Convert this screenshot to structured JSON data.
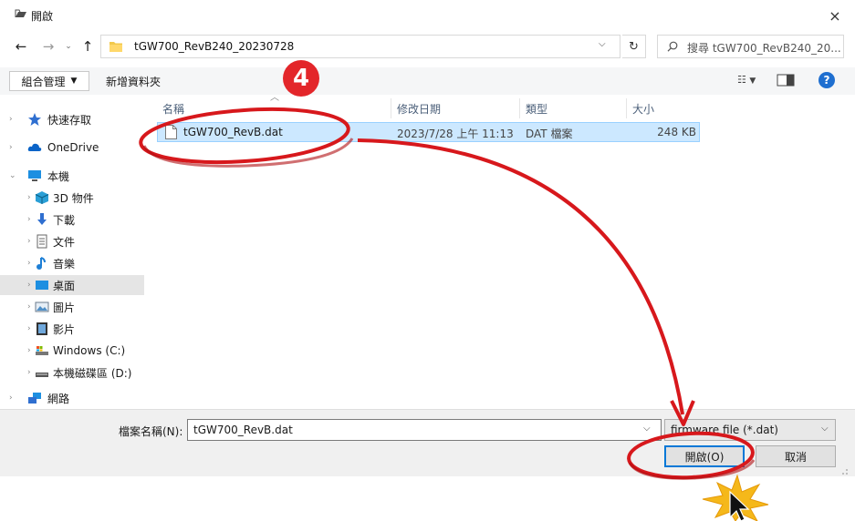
{
  "window": {
    "title": "開啟",
    "title_icon": "open-folder-icon",
    "close_glyph": "×"
  },
  "address_bar": {
    "path": "tGW700_RevB240_20230728",
    "search_placeholder": "搜尋 tGW700_RevB240_20..."
  },
  "toolbar": {
    "organize_label": "組合管理",
    "new_folder_label": "新增資料夾"
  },
  "columns": {
    "name": "名稱",
    "date": "修改日期",
    "type": "類型",
    "size": "大小"
  },
  "files": [
    {
      "name": "tGW700_RevB.dat",
      "date": "2023/7/28 上午 11:13",
      "type": "DAT 檔案",
      "size": "248 KB"
    }
  ],
  "nav": [
    {
      "label": "快速存取",
      "icon": "star-icon"
    },
    {
      "label": "OneDrive",
      "icon": "cloud-icon"
    },
    {
      "label": "本機",
      "icon": "computer-icon"
    },
    {
      "label": "3D 物件",
      "icon": "cube-icon"
    },
    {
      "label": "下載",
      "icon": "download-icon"
    },
    {
      "label": "文件",
      "icon": "document-icon"
    },
    {
      "label": "音樂",
      "icon": "music-icon"
    },
    {
      "label": "桌面",
      "icon": "desktop-icon"
    },
    {
      "label": "圖片",
      "icon": "picture-icon"
    },
    {
      "label": "影片",
      "icon": "video-icon"
    },
    {
      "label": "Windows (C:)",
      "icon": "drive-c-icon"
    },
    {
      "label": "本機磁碟區 (D:)",
      "icon": "drive-d-icon"
    },
    {
      "label": "網路",
      "icon": "network-icon"
    }
  ],
  "bottom": {
    "filename_label": "檔案名稱(N):",
    "filename_value": "tGW700_RevB.dat",
    "filetype_value": "firmware file (*.dat)",
    "open_label": "開啟(O)",
    "cancel_label": "取消"
  },
  "annotation": {
    "step_number": "4",
    "color": "#e3262a"
  }
}
